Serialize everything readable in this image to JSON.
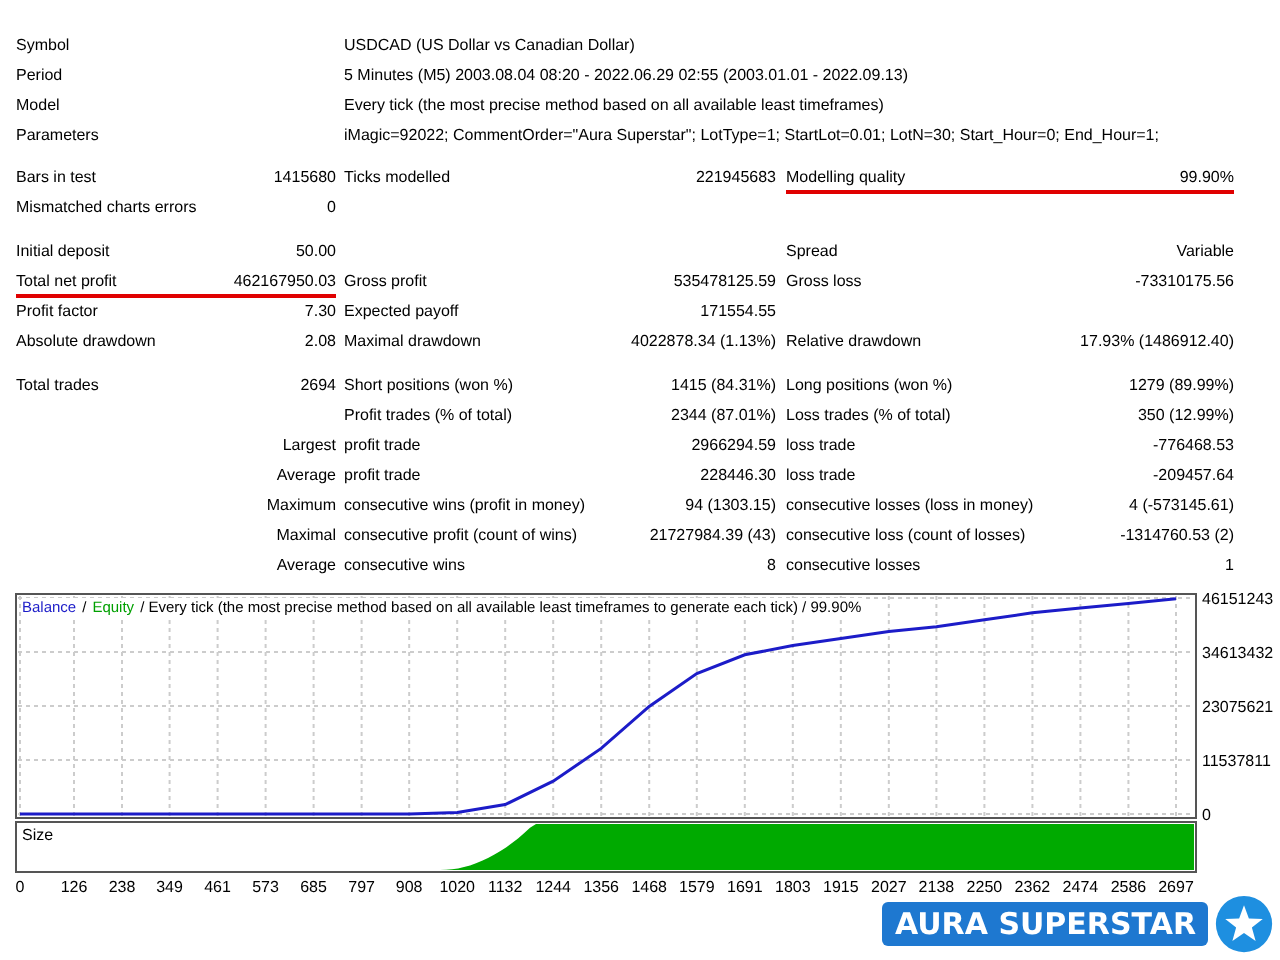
{
  "info": [
    {
      "label": "Symbol",
      "value": "USDCAD (US Dollar vs Canadian Dollar)"
    },
    {
      "label": "Period",
      "value": "5 Minutes (M5) 2003.08.04 08:20 - 2022.06.29 02:55 (2003.01.01 - 2022.09.13)"
    },
    {
      "label": "Model",
      "value": "Every tick (the most precise method based on all available least timeframes)"
    },
    {
      "label": "Parameters",
      "value": "iMagic=92022; CommentOrder=\"Aura Superstar\"; LotType=1; StartLot=0.01; LotN=30; Start_Hour=0; End_Hour=1;"
    }
  ],
  "sections": [
    [
      {
        "left": {
          "label": "Bars in test",
          "value": "1415680"
        },
        "middle": {
          "label": "Ticks modelled",
          "value": "221945683"
        },
        "right": {
          "label": "Modelling quality",
          "value": "99.90%",
          "underlined": true
        }
      },
      {
        "left": {
          "label": "Mismatched charts errors",
          "value": "0"
        }
      }
    ],
    [
      {
        "left": {
          "label": "Initial deposit",
          "value": "50.00"
        },
        "right": {
          "label": "Spread",
          "value": "Variable"
        }
      },
      {
        "left": {
          "label": "Total net profit",
          "value": "462167950.03",
          "underlined": true
        },
        "middle": {
          "label": "Gross profit",
          "value": "535478125.59"
        },
        "right": {
          "label": "Gross loss",
          "value": "-73310175.56"
        }
      },
      {
        "left": {
          "label": "Profit factor",
          "value": "7.30"
        },
        "middle": {
          "label": "Expected payoff",
          "value": "171554.55"
        }
      },
      {
        "left": {
          "label": "Absolute drawdown",
          "value": "2.08"
        },
        "middle": {
          "label": "Maximal drawdown",
          "value": "4022878.34 (1.13%)"
        },
        "right": {
          "label": "Relative drawdown",
          "value": "17.93% (1486912.40)"
        }
      }
    ],
    [
      {
        "left": {
          "label": "Total trades",
          "value": "2694"
        },
        "middle": {
          "label": "Short positions (won %)",
          "value": "1415 (84.31%)"
        },
        "right": {
          "label": "Long positions (won %)",
          "value": "1279 (89.99%)"
        }
      },
      {
        "middle": {
          "label": "Profit trades (% of total)",
          "value": "2344 (87.01%)"
        },
        "right": {
          "label": "Loss trades (% of total)",
          "value": "350 (12.99%)"
        }
      },
      {
        "left": {
          "value": "Largest"
        },
        "middle": {
          "label": "profit trade",
          "value": "2966294.59"
        },
        "right": {
          "label": "loss trade",
          "value": "-776468.53"
        }
      },
      {
        "left": {
          "value": "Average"
        },
        "middle": {
          "label": "profit trade",
          "value": "228446.30"
        },
        "right": {
          "label": "loss trade",
          "value": "-209457.64"
        }
      },
      {
        "left": {
          "value": "Maximum"
        },
        "middle": {
          "label": "consecutive wins (profit in money)",
          "value": "94 (1303.15)"
        },
        "right": {
          "label": "consecutive losses (loss in money)",
          "value": "4 (-573145.61)"
        }
      },
      {
        "left": {
          "value": "Maximal"
        },
        "middle": {
          "label": "consecutive profit (count of wins)",
          "value": "21727984.39 (43)"
        },
        "right": {
          "label": "consecutive loss (count of losses)",
          "value": "-1314760.53 (2)"
        }
      },
      {
        "left": {
          "value": "Average"
        },
        "middle": {
          "label": "consecutive wins",
          "value": "8"
        },
        "right": {
          "label": "consecutive losses",
          "value": "1"
        }
      }
    ]
  ],
  "chart": {
    "legend": [
      {
        "text": "/",
        "color": "#000000"
      },
      {
        "text": "Equity",
        "color": "#00a000"
      },
      {
        "text": "/ Every tick (the most precise method based on all available least timeframes to generate each tick) / 99.90%",
        "color": "#000000"
      }
    ],
    "size_label": "Size",
    "chart_data": {
      "type": "line",
      "grid": true,
      "x": [
        0,
        908,
        1020,
        1132,
        1244,
        1356,
        1468,
        1579,
        1691,
        1803,
        1915,
        2027,
        2138,
        2250,
        2362,
        2474,
        2586,
        2697
      ],
      "series": [
        {
          "name": "Balance",
          "color": "#1c1cc8",
          "values": [
            0,
            0,
            300000,
            2000000,
            7000000,
            14000000,
            23000000,
            30000000,
            34000000,
            36000000,
            37500000,
            39000000,
            40000000,
            41500000,
            43000000,
            44000000,
            45000000,
            46000000
          ]
        }
      ],
      "xlim": [
        0,
        2697
      ],
      "ylim": [
        0,
        46151243
      ],
      "xticks": [
        0,
        126,
        238,
        349,
        461,
        573,
        685,
        797,
        908,
        1020,
        1132,
        1244,
        1356,
        1468,
        1579,
        1691,
        1803,
        1915,
        2027,
        2138,
        2250,
        2362,
        2474,
        2586,
        2697
      ],
      "yticks": [
        0,
        11537811,
        23075621,
        34613432,
        46151243
      ]
    }
  },
  "badge": {
    "text": "AURA SUPERSTAR"
  }
}
